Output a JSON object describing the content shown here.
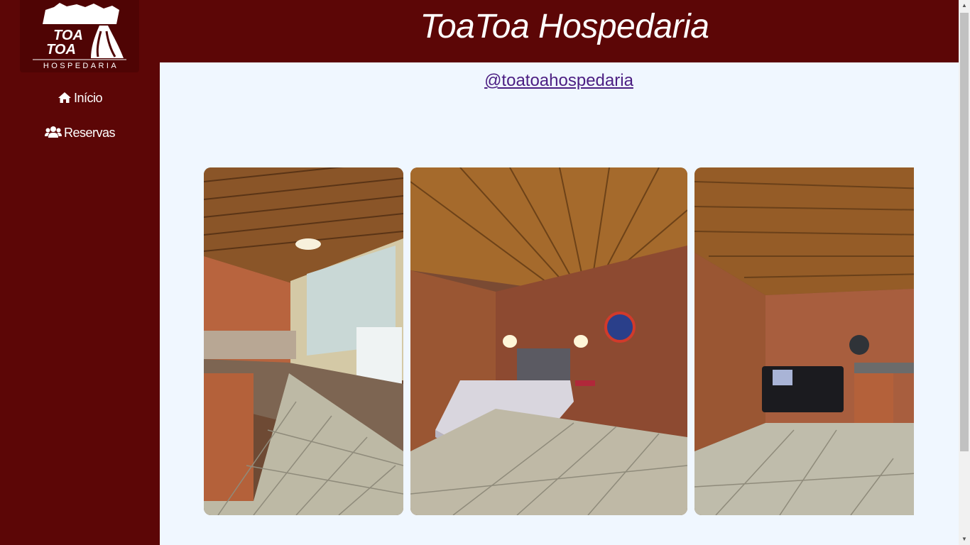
{
  "brand": {
    "logo_line1": "TOA",
    "logo_line2": "TOA",
    "logo_tagline": "HOSPEDARIA"
  },
  "sidebar": {
    "items": [
      {
        "label": "Início",
        "icon": "home-icon"
      },
      {
        "label": "Reservas",
        "icon": "users-icon"
      }
    ]
  },
  "header": {
    "title": "ToaToa Hospedaria"
  },
  "main": {
    "instagram_handle": "@toatoahospedaria"
  },
  "colors": {
    "sidebar_bg": "#5c0606",
    "page_bg": "#f0f7ff",
    "link": "#4b1e82"
  }
}
